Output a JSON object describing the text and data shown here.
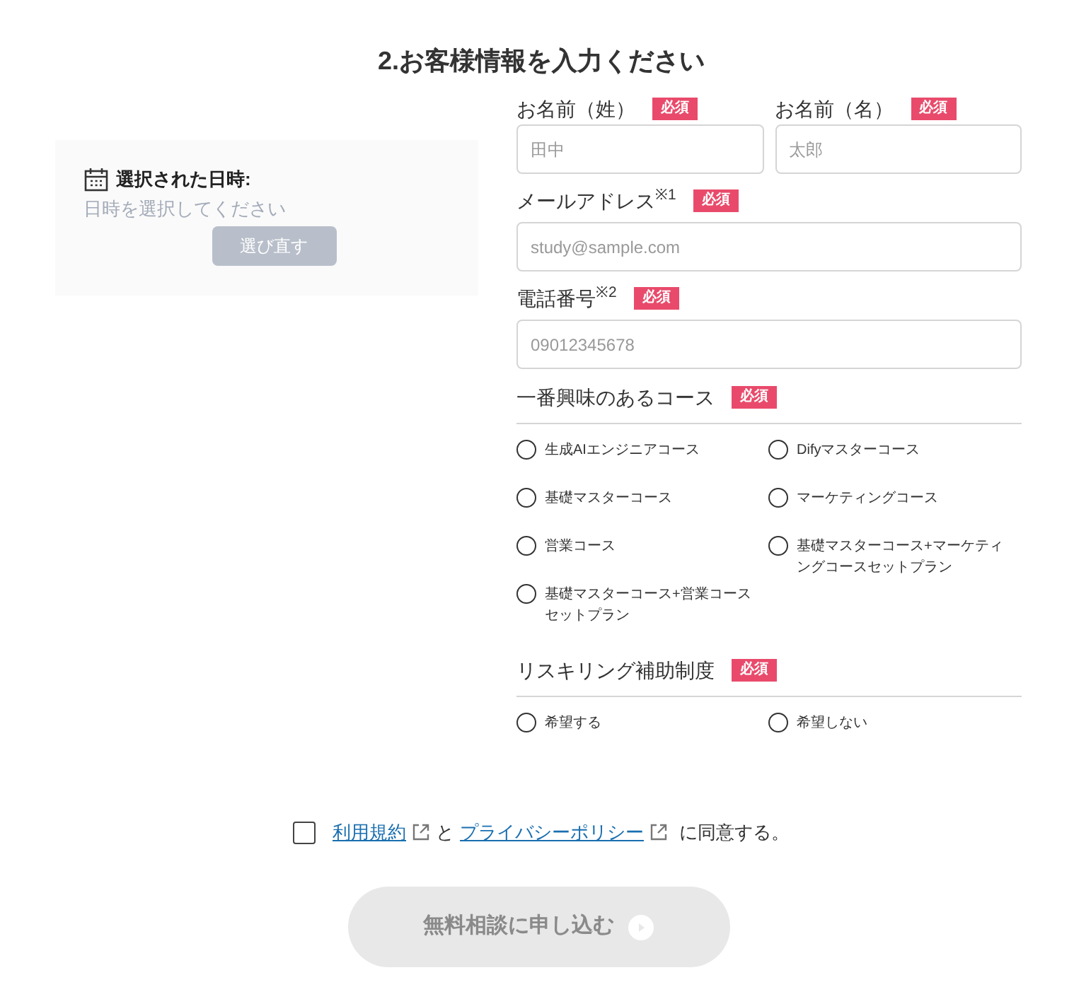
{
  "heading": "2.お客様情報を入力ください",
  "date_panel": {
    "title": "選択された日時:",
    "placeholder": "日時を選択してください",
    "button": {
      "label": "選び直す",
      "disabled": true
    }
  },
  "name_fields": [
    {
      "label": "お名前（姓）",
      "badge": "必須",
      "placeholder": "田中"
    },
    {
      "label": "お名前（名）",
      "badge": "必須",
      "placeholder": "太郎"
    }
  ],
  "fields": [
    {
      "label": "メールアドレス$^{※1}$",
      "badge": "必須",
      "placeholder": "study@sample.com"
    },
    {
      "label": "電話番号$^{※2}$",
      "badge": "必須",
      "placeholder": "09012345678"
    }
  ],
  "radio_groups": [
    {
      "title": "一番興味のあるコース",
      "badge": "必須",
      "options": [
        {
          "label": "生成AIエンジニアコース",
          "selected": false
        },
        {
          "label": "Difyマスターコース",
          "selected": false
        },
        {
          "label": "基礎マスターコース",
          "selected": false
        },
        {
          "label": "マーケティングコース",
          "selected": false
        },
        {
          "label": "営業コース",
          "selected": false
        },
        {
          "label": "基礎マスターコース+マーケティングコースセットプラン",
          "selected": false
        },
        {
          "label": "基礎マスターコース+営業コースセットプラン",
          "selected": false
        }
      ]
    },
    {
      "title": "リスキリング補助制度",
      "badge": "必須",
      "options": [
        {
          "label": "希望する",
          "selected": false
        },
        {
          "label": "希望しない",
          "selected": false
        }
      ]
    }
  ],
  "agreement": {
    "checked": false,
    "terms_link": "利用規約",
    "joiner": "と",
    "privacy_link": "プライバシーポリシー",
    "suffix": "に同意する。"
  },
  "submit": {
    "label": "無料相談に申し込む",
    "disabled": true
  }
}
